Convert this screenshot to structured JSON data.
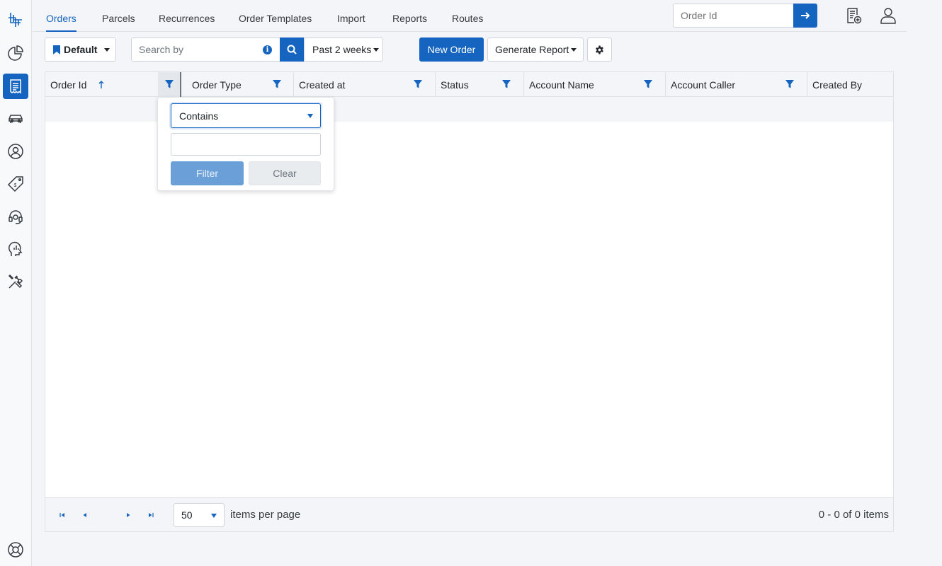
{
  "nav": {
    "tabs": [
      {
        "label": "Orders",
        "active": true
      },
      {
        "label": "Parcels"
      },
      {
        "label": "Recurrences"
      },
      {
        "label": "Order Templates"
      },
      {
        "label": "Import"
      },
      {
        "label": "Reports"
      },
      {
        "label": "Routes"
      }
    ],
    "order_id_placeholder": "Order Id"
  },
  "toolbar": {
    "view_label": "Default",
    "search_placeholder": "Search by",
    "date_range_label": "Past 2 weeks",
    "new_order_label": "New Order",
    "generate_report_label": "Generate Report"
  },
  "grid": {
    "columns": [
      "Order Id",
      "Order Type",
      "Created at",
      "Status",
      "Account Name",
      "Account Caller",
      "Created By"
    ],
    "sort_column": "Order Id",
    "sort_direction": "asc"
  },
  "filter_popup": {
    "operator": "Contains",
    "value": "",
    "filter_label": "Filter",
    "clear_label": "Clear"
  },
  "pager": {
    "page_size": "50",
    "items_per_page_label": "items per page",
    "summary": "0 - 0 of 0 items"
  },
  "colors": {
    "primary": "#1565c0",
    "border": "#dee2e6",
    "background": "#f4f5f8"
  },
  "icons": {
    "rail": [
      "logo-icon",
      "dashboard-pie-icon",
      "orders-receipt-icon",
      "vehicle-icon",
      "user-circle-icon",
      "price-tag-icon",
      "support-headset-icon",
      "analytics-head-icon",
      "tools-icon",
      "help-lifebuoy-icon"
    ],
    "top": [
      "add-document-icon",
      "user-profile-icon"
    ]
  }
}
